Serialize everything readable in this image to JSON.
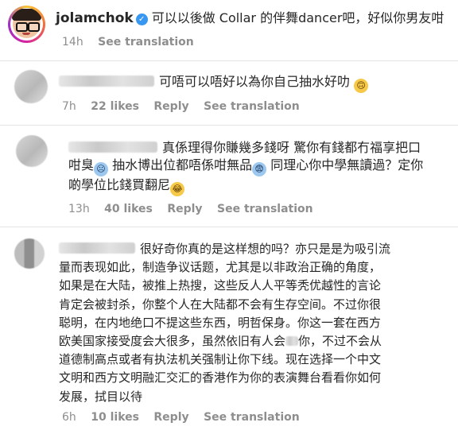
{
  "post": {
    "username": "jolamchok",
    "caption": "可以以後做 Collar 的伴舞dancer吧，好似你男友咁",
    "time": "14h",
    "see_translation": "See translation"
  },
  "comments": [
    {
      "text": "可唔可以唔好以為你自己抽水好叻",
      "emoji": "🙃",
      "time": "7h",
      "likes": "22 likes",
      "reply": "Reply",
      "see_translation": "See translation"
    },
    {
      "line1": "真係理得你賺幾多錢呀 驚你有錢都冇福享把口",
      "line2a": "咁臭",
      "line2b": "抽水博出位都唔係咁無品",
      "line2c": "同理心你中學無讀過？定你",
      "line3": "啲學位比錢買翻尼",
      "time": "13h",
      "likes": "40 likes",
      "reply": "Reply",
      "see_translation": "See translation"
    },
    {
      "line1": "很好奇你真的是这样想的吗？亦只是是为吸引流",
      "line2": "量而表现如此，制造争议话题，尤其是以非政治正确的角度，",
      "line3": "如果是在大陆，被推上热搜，这些反人人平等秃优越性的言论",
      "line4": "肯定会被封杀，你整个人在大陆都不会有生存空间。不过你很",
      "line5": "聪明，在内地绝口不提这些东西，明哲保身。你这一套在西方",
      "line6a": "欧美国家接受度会大很多，虽然依旧有人会",
      "line6b": "你，不过不会从",
      "line7": "道德制高点或者有执法机关强制让你下线。现在选择一个中文",
      "line8": "文明和西方文明融汇交汇的香港作为你的表演舞台看看你如何",
      "line9": "发展，拭目以待",
      "time": "6h",
      "likes": "10 likes",
      "reply": "Reply",
      "see_translation": "See translation"
    }
  ]
}
